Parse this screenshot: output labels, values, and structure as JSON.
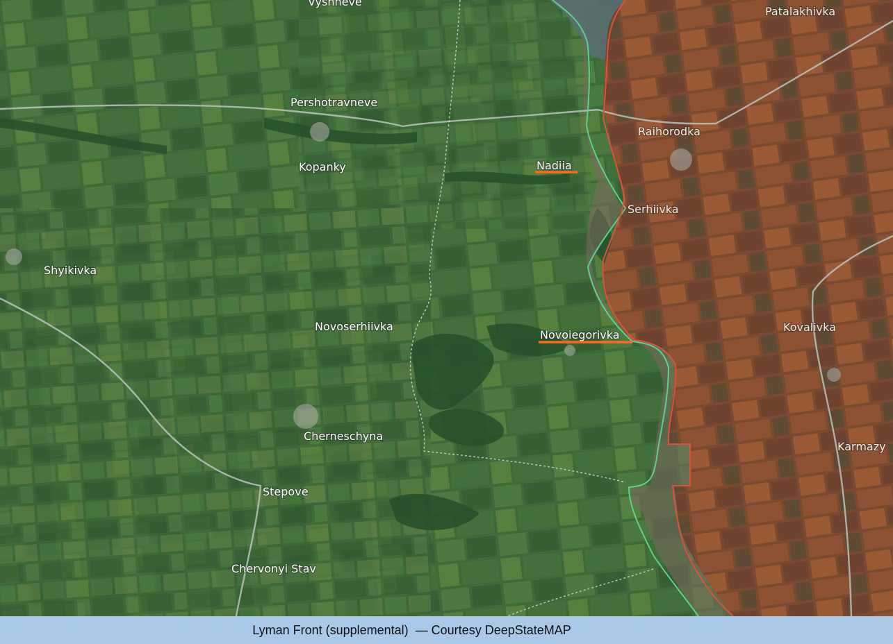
{
  "map": {
    "places": [
      {
        "id": "vyshneve",
        "name": "Vyshneve"
      },
      {
        "id": "patalakhivka",
        "name": "Patalakhivka"
      },
      {
        "id": "pershotravneve",
        "name": "Pershotravneve"
      },
      {
        "id": "raihorodka",
        "name": "Raihorodka"
      },
      {
        "id": "kopanky",
        "name": "Kopanky"
      },
      {
        "id": "nadiia",
        "name": "Nadiia"
      },
      {
        "id": "serhiivka",
        "name": "Serhiivka"
      },
      {
        "id": "shyikivka",
        "name": "Shyikivka"
      },
      {
        "id": "novoserhiivka",
        "name": "Novoserhiivka"
      },
      {
        "id": "novoiegorivka",
        "name": "Novoiegorivka"
      },
      {
        "id": "kovalivka",
        "name": "Kovalivka"
      },
      {
        "id": "cherneschyna",
        "name": "Cherneschyna"
      },
      {
        "id": "karmazy",
        "name": "Karmazy"
      },
      {
        "id": "stepove",
        "name": "Stepove"
      },
      {
        "id": "chervonyi_stav",
        "name": "Chervonyi Stav"
      }
    ],
    "highlighted": [
      "Nadiia",
      "Novoiegorivka"
    ],
    "colors": {
      "highlight_underline": "#ff6a1a",
      "front_line_green": "#59d28c",
      "front_line_red": "#e0503a",
      "occupied_tint": "#9b3a22",
      "vegetation": "#3f6b3a",
      "caption_bg": "#a9c9e8"
    }
  },
  "caption": {
    "text": "Lyman Front (supplemental)  — Courtesy DeepStateMAP"
  }
}
